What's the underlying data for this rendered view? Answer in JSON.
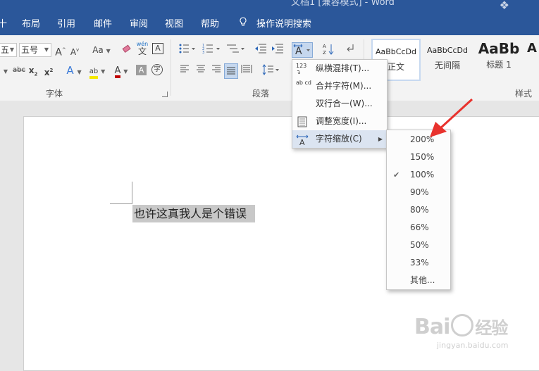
{
  "window": {
    "title": "文档1 [兼容模式] - Word"
  },
  "tabs": [
    {
      "label": "十"
    },
    {
      "label": "布局"
    },
    {
      "label": "引用"
    },
    {
      "label": "邮件"
    },
    {
      "label": "审阅"
    },
    {
      "label": "视图"
    },
    {
      "label": "帮助"
    }
  ],
  "tell_me": {
    "label": "操作说明搜索"
  },
  "ribbon": {
    "font_group": {
      "label": "字体",
      "font_name_value": "五",
      "font_size_value": "五号",
      "grow_label": "A",
      "shrink_label": "A",
      "case_label": "Aa",
      "clear_label": "A",
      "phonetic_top": "wén",
      "phonetic_bottom": "文",
      "border_char_label": "A",
      "strike_label": "abc",
      "sub_label": "x",
      "sub_script": "2",
      "sup_label": "x",
      "sup_script": "2",
      "effects_label": "A",
      "highlight_label": "ab",
      "font_color_label": "A",
      "shading_label": "A",
      "enclose_label": "字"
    },
    "paragraph_group": {
      "label": "段落"
    },
    "styles_group": {
      "label": "样式",
      "items": [
        {
          "sample": "AaBbCcDd",
          "name": "正文"
        },
        {
          "sample": "AaBbCcDd",
          "name": "无间隔"
        },
        {
          "sample": "AaBb",
          "name": "标题 1"
        },
        {
          "sample": "A",
          "name": ""
        }
      ]
    }
  },
  "document": {
    "text": "也许这真我人是个错误"
  },
  "asian_layout_menu": {
    "items": [
      {
        "icon": "vertical-text-icon",
        "icon_text": "123",
        "label": "纵横混排(T)..."
      },
      {
        "icon": "combine-chars-icon",
        "icon_text": "ab cd",
        "label": "合并字符(M)..."
      },
      {
        "icon": "",
        "icon_text": "",
        "label": "双行合一(W)..."
      },
      {
        "icon": "adjust-width-icon",
        "icon_text": "",
        "label": "调整宽度(I)..."
      },
      {
        "icon": "char-scale-icon",
        "icon_text": "A",
        "label": "字符缩放(C)",
        "has_submenu": true
      }
    ]
  },
  "char_scale_submenu": {
    "checked_value": "100%",
    "items": [
      "200%",
      "150%",
      "100%",
      "90%",
      "80%",
      "66%",
      "50%",
      "33%",
      "其他..."
    ]
  },
  "annotation": {
    "arrow_color": "#e8322d",
    "points_to": "200%"
  },
  "watermark": {
    "brand": "Bai",
    "brand_cn": "经验",
    "url": "jingyan.baidu.com"
  },
  "colors": {
    "title_blue": "#2b579a",
    "highlight_yellow": "#f5e800",
    "font_color_red": "#c00000",
    "menu_hover": "#dbe4f1"
  }
}
